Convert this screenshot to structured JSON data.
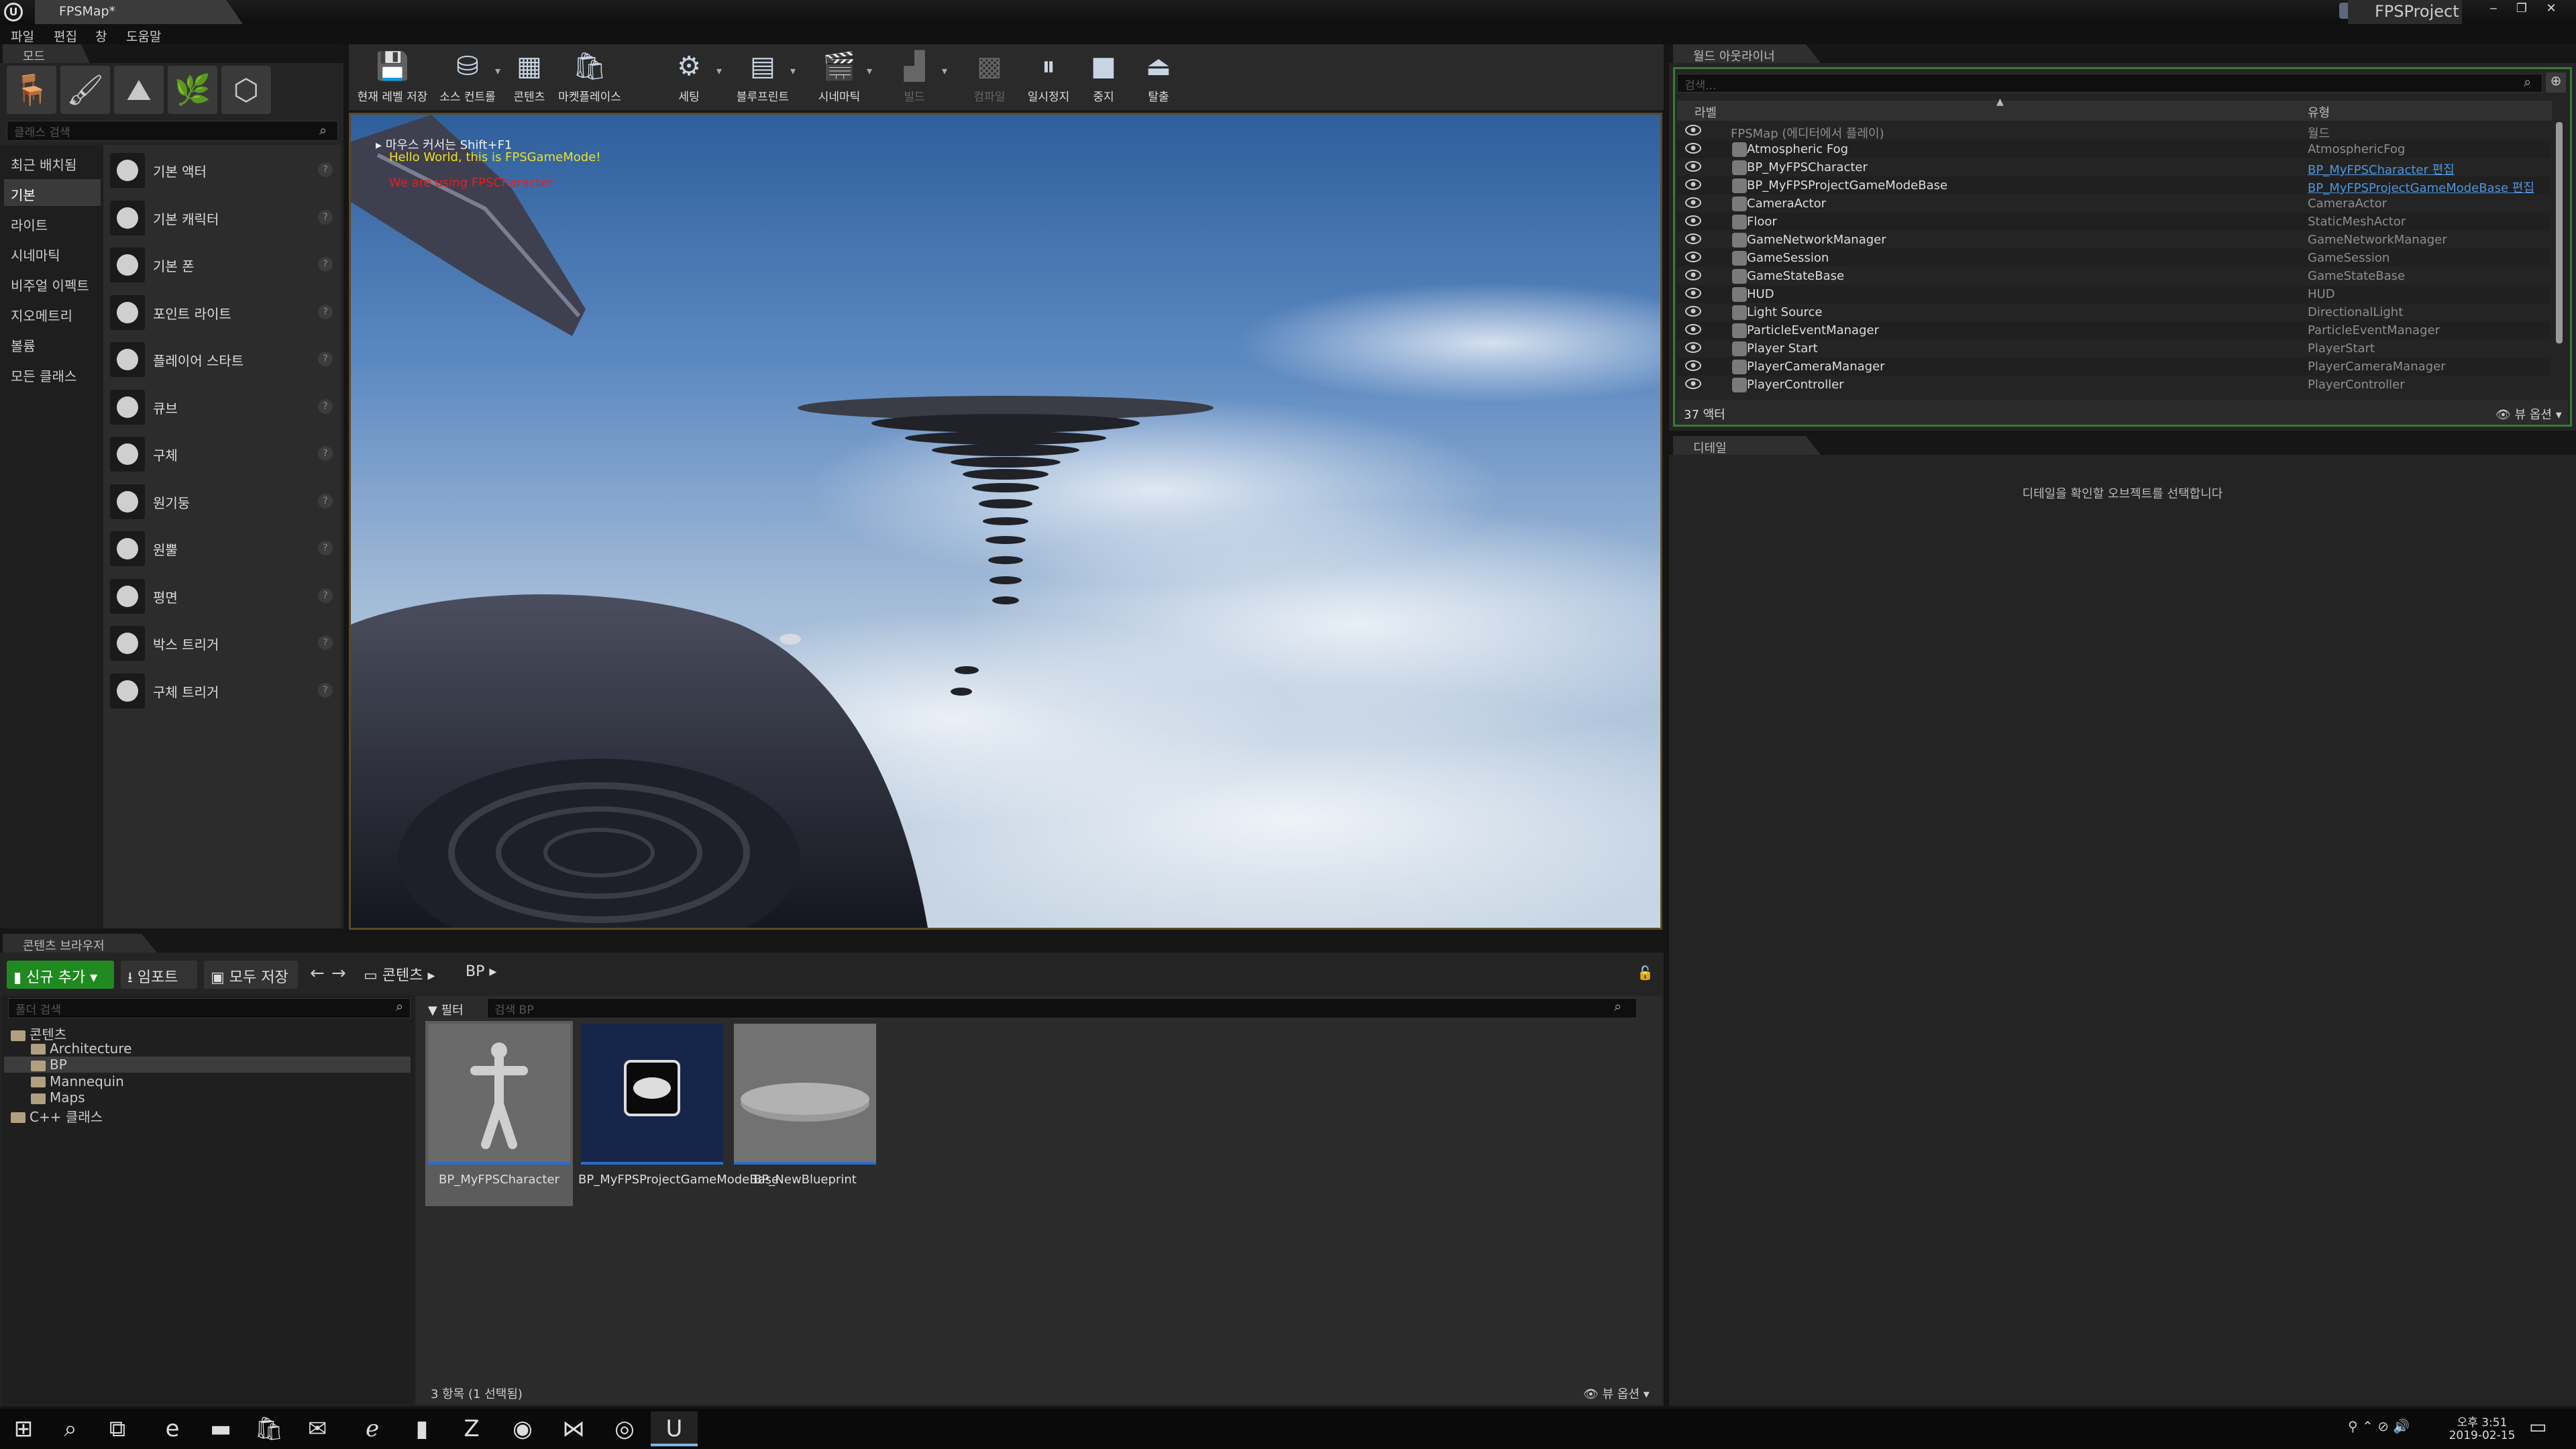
{
  "window": {
    "tab": "FPSMap*",
    "project": "FPSProject",
    "controls": {
      "minimize": "‒",
      "restore": "❐",
      "close": "✕"
    }
  },
  "menu": [
    "파일",
    "편집",
    "창",
    "도움말"
  ],
  "modes": {
    "tab": "모드",
    "search_placeholder": "클래스 검색",
    "icons": [
      "place-mode-icon",
      "paint-mode-icon",
      "landscape-mode-icon",
      "foliage-mode-icon",
      "geometry-mode-icon"
    ],
    "categories": [
      "최근 배치됨",
      "기본",
      "라이트",
      "시네마틱",
      "비주얼 이펙트",
      "지오메트리",
      "볼륨",
      "모든 클래스"
    ],
    "selected_category": "기본",
    "items": [
      "기본 액터",
      "기본 캐릭터",
      "기본 폰",
      "포인트 라이트",
      "플레이어 스타트",
      "큐브",
      "구체",
      "원기둥",
      "원뿔",
      "평면",
      "박스 트리거",
      "구체 트리거"
    ]
  },
  "toolbar": [
    {
      "label": "현재 레벨 저장",
      "icon": "save-icon",
      "glyph": "💾",
      "enabled": true,
      "dropdown": false
    },
    {
      "label": "소스 컨트롤",
      "icon": "source-control-icon",
      "glyph": "⛁",
      "enabled": true,
      "dropdown": true
    },
    {
      "label": "콘텐츠",
      "icon": "content-icon",
      "glyph": "▦",
      "enabled": true,
      "dropdown": false
    },
    {
      "label": "마켓플레이스",
      "icon": "marketplace-icon",
      "glyph": "🛍",
      "enabled": true,
      "dropdown": false
    },
    {
      "label": "세팅",
      "icon": "settings-icon",
      "glyph": "⚙",
      "enabled": true,
      "dropdown": true
    },
    {
      "label": "블루프린트",
      "icon": "blueprint-icon",
      "glyph": "▤",
      "enabled": true,
      "dropdown": true
    },
    {
      "label": "시네마틱",
      "icon": "cinematic-icon",
      "glyph": "🎬",
      "enabled": true,
      "dropdown": true
    },
    {
      "label": "빌드",
      "icon": "build-icon",
      "glyph": "▟",
      "enabled": false,
      "dropdown": true
    },
    {
      "label": "컴파일",
      "icon": "compile-icon",
      "glyph": "▩",
      "enabled": false,
      "dropdown": false
    },
    {
      "label": "일시정지",
      "icon": "pause-icon",
      "glyph": "⏸",
      "enabled": true,
      "dropdown": false
    },
    {
      "label": "중지",
      "icon": "stop-icon",
      "glyph": "■",
      "enabled": true,
      "dropdown": false
    },
    {
      "label": "탈출",
      "icon": "eject-icon",
      "glyph": "⏏",
      "enabled": true,
      "dropdown": false
    }
  ],
  "viewport": {
    "hint": "마우스 커서는 Shift+F1",
    "msg1": "Hello World, this is FPSGameMode!",
    "msg2": "We are using FPSCharacter",
    "msg1_color": "#f0e020",
    "msg2_color": "#e02020"
  },
  "outliner": {
    "tab": "월드 아웃라이너",
    "search_placeholder": "검색...",
    "col_label": "라벨",
    "col_type": "유형",
    "root": {
      "label": "FPSMap (에디터에서 플레이)",
      "type": "월드"
    },
    "rows": [
      {
        "label": "Atmospheric Fog",
        "type": "AtmosphericFog",
        "link": false
      },
      {
        "label": "BP_MyFPSCharacter",
        "type": "BP_MyFPSCharacter 편집",
        "link": true
      },
      {
        "label": "BP_MyFPSProjectGameModeBase",
        "type": "BP_MyFPSProjectGameModeBase 편집",
        "link": true
      },
      {
        "label": "CameraActor",
        "type": "CameraActor",
        "link": false
      },
      {
        "label": "Floor",
        "type": "StaticMeshActor",
        "link": false
      },
      {
        "label": "GameNetworkManager",
        "type": "GameNetworkManager",
        "link": false
      },
      {
        "label": "GameSession",
        "type": "GameSession",
        "link": false
      },
      {
        "label": "GameStateBase",
        "type": "GameStateBase",
        "link": false
      },
      {
        "label": "HUD",
        "type": "HUD",
        "link": false
      },
      {
        "label": "Light Source",
        "type": "DirectionalLight",
        "link": false
      },
      {
        "label": "ParticleEventManager",
        "type": "ParticleEventManager",
        "link": false
      },
      {
        "label": "Player Start",
        "type": "PlayerStart",
        "link": false
      },
      {
        "label": "PlayerCameraManager",
        "type": "PlayerCameraManager",
        "link": false
      },
      {
        "label": "PlayerController",
        "type": "PlayerController",
        "link": false
      }
    ],
    "count": "37 액터",
    "view_options": "뷰 옵션"
  },
  "details": {
    "tab": "디테일",
    "empty": "디테일을 확인할 오브젝트를 선택합니다"
  },
  "content_browser": {
    "tab": "콘텐츠 브라우저",
    "add_new": "신규 추가",
    "import": "임포트",
    "save_all": "모두 저장",
    "path": [
      "콘텐츠",
      "BP"
    ],
    "folder_search_placeholder": "폴더 검색",
    "filter": "필터",
    "asset_search_placeholder": "검색 BP",
    "tree": [
      {
        "label": "콘텐츠",
        "depth": 0
      },
      {
        "label": "Architecture",
        "depth": 1
      },
      {
        "label": "BP",
        "depth": 1
      },
      {
        "label": "Mannequin",
        "depth": 1
      },
      {
        "label": "Maps",
        "depth": 1
      },
      {
        "label": "C++ 클래스",
        "depth": 0
      }
    ],
    "selected_folder": "BP",
    "assets": [
      {
        "label": "BP_MyFPSCharacter",
        "kind": "character-thumbnail",
        "selected": true
      },
      {
        "label": "BP_MyFPSProjectGameModeBase",
        "kind": "gamemode-thumbnail",
        "selected": false
      },
      {
        "label": "BP_NewBlueprint",
        "kind": "actor-thumbnail",
        "selected": false
      }
    ],
    "status": "3 항목 (1 선택됨)",
    "view_options": "뷰 옵션"
  },
  "taskbar": {
    "icons": [
      {
        "name": "start-icon",
        "glyph": "⊞"
      },
      {
        "name": "search-icon",
        "glyph": "⌕"
      },
      {
        "name": "task-view-icon",
        "glyph": "⧉"
      },
      {
        "name": "edge-icon",
        "glyph": "e"
      },
      {
        "name": "file-explorer-icon",
        "glyph": "▬"
      },
      {
        "name": "store-icon",
        "glyph": "🛍"
      },
      {
        "name": "mail-icon",
        "glyph": "✉"
      },
      {
        "name": "ie-icon",
        "glyph": "ℯ"
      },
      {
        "name": "sticky-notes-icon",
        "glyph": "▮"
      },
      {
        "name": "zoom-icon",
        "glyph": "Z"
      },
      {
        "name": "steam-icon",
        "glyph": "◉"
      },
      {
        "name": "visual-studio-icon",
        "glyph": "⋈"
      },
      {
        "name": "chrome-icon",
        "glyph": "◎"
      },
      {
        "name": "unreal-icon",
        "glyph": "U"
      }
    ],
    "time": "오후 3:51",
    "date": "2019-02-15"
  }
}
